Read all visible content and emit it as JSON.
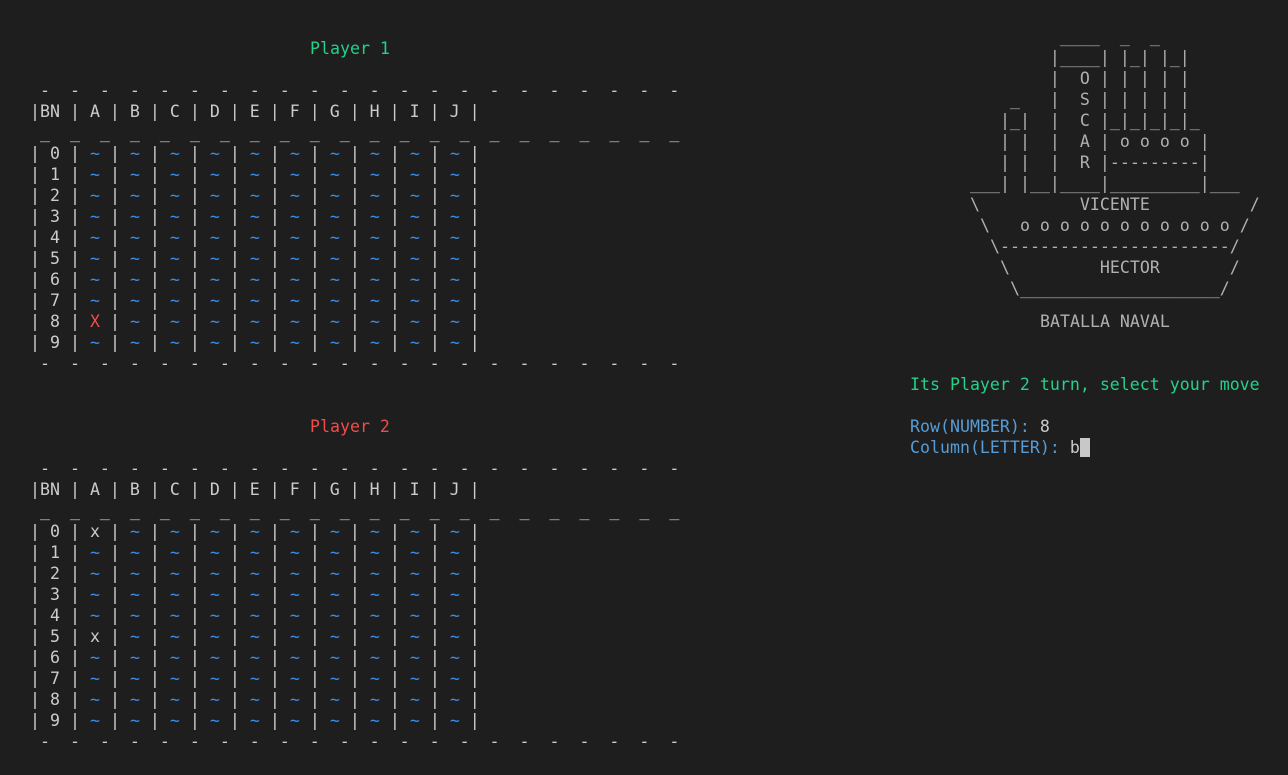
{
  "board_header": "|BN | A | B | C | D | E | F | G | H | I | J |",
  "dash_line": " -  -  -  -  -  -  -  -  -  -  -  -  -  -  -  -  -  -  -  -  -  -",
  "under_line": " _  _  _  _  _  _  _  _  _  _  _  _  _  _  _  _  _  _  _  _  _  _",
  "player1": {
    "title": "Player 1",
    "rows": [
      {
        "label": "| 0 |",
        "cells": [
          "~",
          "~",
          "~",
          "~",
          "~",
          "~",
          "~",
          "~",
          "~",
          "~"
        ]
      },
      {
        "label": "| 1 |",
        "cells": [
          "~",
          "~",
          "~",
          "~",
          "~",
          "~",
          "~",
          "~",
          "~",
          "~"
        ]
      },
      {
        "label": "| 2 |",
        "cells": [
          "~",
          "~",
          "~",
          "~",
          "~",
          "~",
          "~",
          "~",
          "~",
          "~"
        ]
      },
      {
        "label": "| 3 |",
        "cells": [
          "~",
          "~",
          "~",
          "~",
          "~",
          "~",
          "~",
          "~",
          "~",
          "~"
        ]
      },
      {
        "label": "| 4 |",
        "cells": [
          "~",
          "~",
          "~",
          "~",
          "~",
          "~",
          "~",
          "~",
          "~",
          "~"
        ]
      },
      {
        "label": "| 5 |",
        "cells": [
          "~",
          "~",
          "~",
          "~",
          "~",
          "~",
          "~",
          "~",
          "~",
          "~"
        ]
      },
      {
        "label": "| 6 |",
        "cells": [
          "~",
          "~",
          "~",
          "~",
          "~",
          "~",
          "~",
          "~",
          "~",
          "~"
        ]
      },
      {
        "label": "| 7 |",
        "cells": [
          "~",
          "~",
          "~",
          "~",
          "~",
          "~",
          "~",
          "~",
          "~",
          "~"
        ]
      },
      {
        "label": "| 8 |",
        "cells": [
          "X",
          "~",
          "~",
          "~",
          "~",
          "~",
          "~",
          "~",
          "~",
          "~"
        ]
      },
      {
        "label": "| 9 |",
        "cells": [
          "~",
          "~",
          "~",
          "~",
          "~",
          "~",
          "~",
          "~",
          "~",
          "~"
        ]
      }
    ]
  },
  "player2": {
    "title": "Player 2",
    "rows": [
      {
        "label": "| 0 |",
        "cells": [
          "x",
          "~",
          "~",
          "~",
          "~",
          "~",
          "~",
          "~",
          "~",
          "~"
        ]
      },
      {
        "label": "| 1 |",
        "cells": [
          "~",
          "~",
          "~",
          "~",
          "~",
          "~",
          "~",
          "~",
          "~",
          "~"
        ]
      },
      {
        "label": "| 2 |",
        "cells": [
          "~",
          "~",
          "~",
          "~",
          "~",
          "~",
          "~",
          "~",
          "~",
          "~"
        ]
      },
      {
        "label": "| 3 |",
        "cells": [
          "~",
          "~",
          "~",
          "~",
          "~",
          "~",
          "~",
          "~",
          "~",
          "~"
        ]
      },
      {
        "label": "| 4 |",
        "cells": [
          "~",
          "~",
          "~",
          "~",
          "~",
          "~",
          "~",
          "~",
          "~",
          "~"
        ]
      },
      {
        "label": "| 5 |",
        "cells": [
          "x",
          "~",
          "~",
          "~",
          "~",
          "~",
          "~",
          "~",
          "~",
          "~"
        ]
      },
      {
        "label": "| 6 |",
        "cells": [
          "~",
          "~",
          "~",
          "~",
          "~",
          "~",
          "~",
          "~",
          "~",
          "~"
        ]
      },
      {
        "label": "| 7 |",
        "cells": [
          "~",
          "~",
          "~",
          "~",
          "~",
          "~",
          "~",
          "~",
          "~",
          "~"
        ]
      },
      {
        "label": "| 8 |",
        "cells": [
          "~",
          "~",
          "~",
          "~",
          "~",
          "~",
          "~",
          "~",
          "~",
          "~"
        ]
      },
      {
        "label": "| 9 |",
        "cells": [
          "~",
          "~",
          "~",
          "~",
          "~",
          "~",
          "~",
          "~",
          "~",
          "~"
        ]
      }
    ]
  },
  "ship_art": [
    "         ____  _  _",
    "        |____| |_| |_|",
    "        |  O | | | | |",
    "    _   |  S | | | | |",
    "   |_|  |  C |_|_|_|_|_",
    "   | |  |  A | o o o o |",
    "   | |  |  R |---------|",
    "___| |__|____|_________|___",
    "\\          VICENTE          /",
    " \\   o o o o o o o o o o o /",
    "  \\-----------------------/",
    "   \\         HECTOR       /",
    "    \\____________________/"
  ],
  "game_title": "BATALLA NAVAL",
  "turn_message": "Its Player 2 turn, select your move",
  "prompt": {
    "row_label": "Row(NUMBER):",
    "row_value": "8",
    "col_label": "Column(LETTER):",
    "col_value": "b"
  },
  "colors": {
    "background": "#1e1e1e",
    "player1_title": "#23d18b",
    "player2_title": "#f14c4c",
    "water": "#3b8eea",
    "hit": "#f14c4c",
    "prompt_label": "#569cd6"
  }
}
